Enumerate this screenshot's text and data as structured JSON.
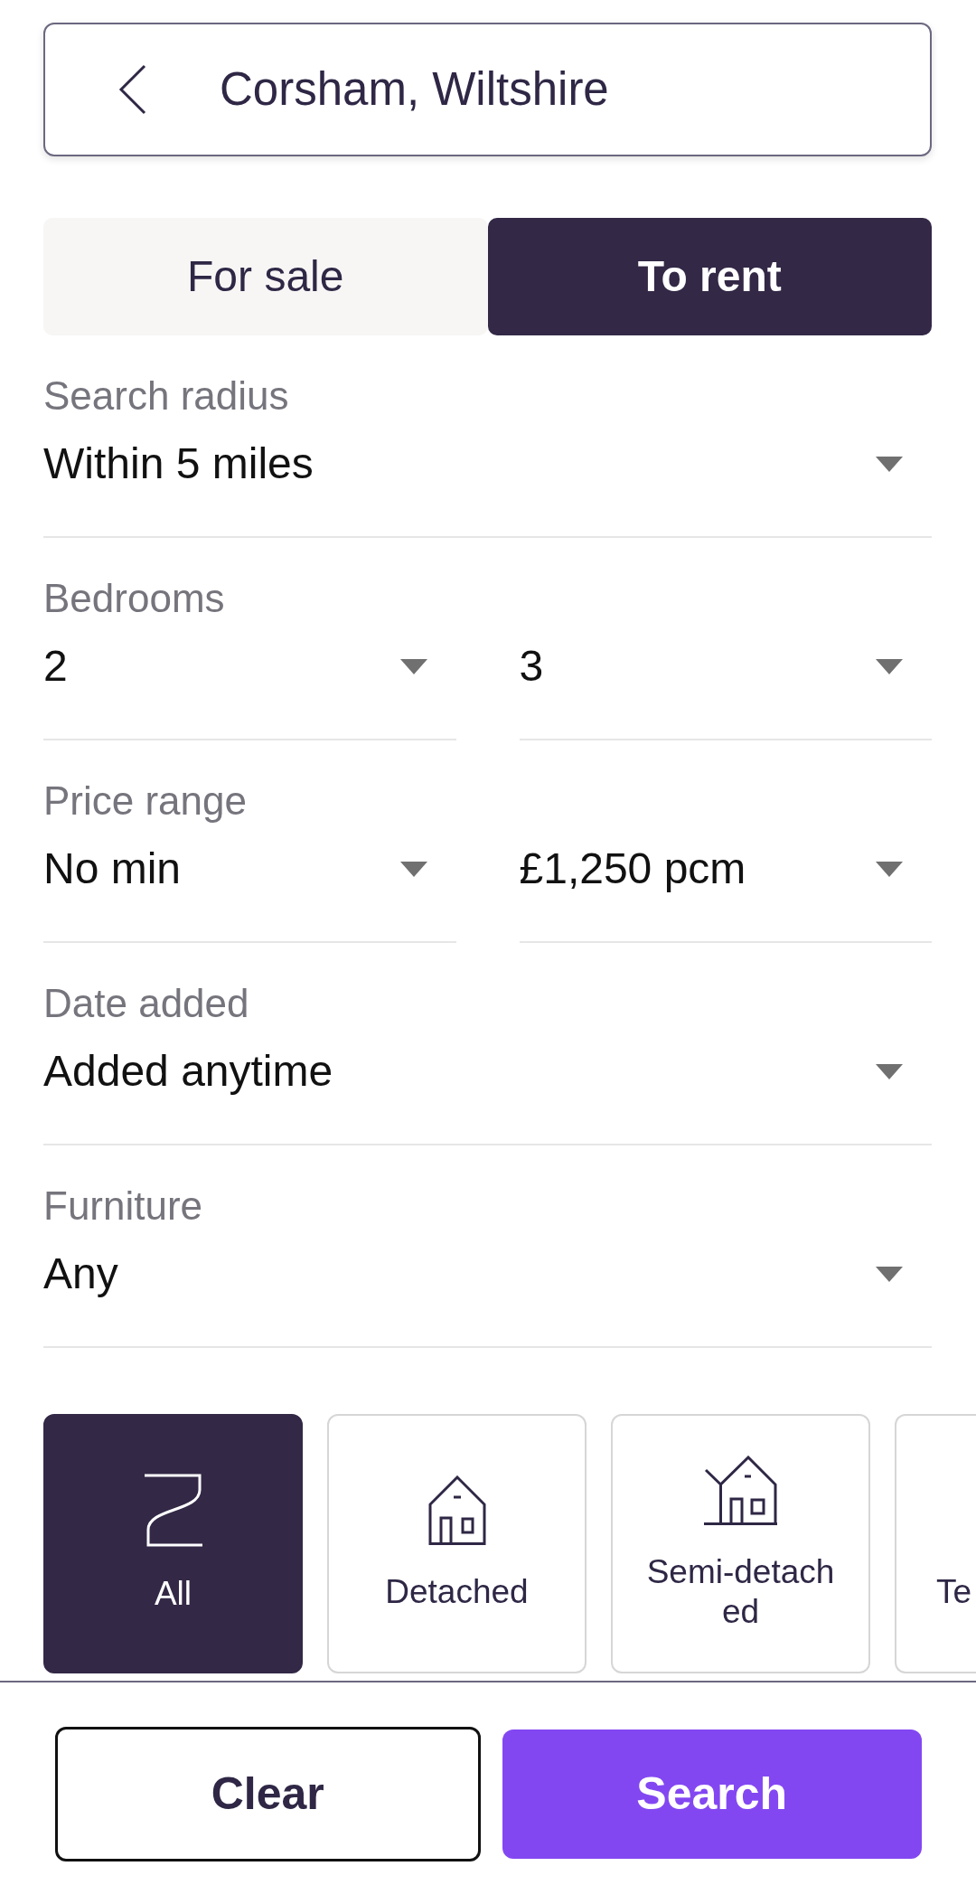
{
  "search_bar": {
    "location": "Corsham, Wiltshire"
  },
  "tabs": [
    {
      "label": "For sale",
      "selected": false
    },
    {
      "label": "To rent",
      "selected": true
    }
  ],
  "filters": [
    {
      "label": "Search radius",
      "dropdowns": [
        {
          "value": "Within 5 miles"
        }
      ]
    },
    {
      "label": "Bedrooms",
      "dropdowns": [
        {
          "value": "2"
        },
        {
          "value": "3"
        }
      ]
    },
    {
      "label": "Price range",
      "dropdowns": [
        {
          "value": "No min"
        },
        {
          "value": "£1,250 pcm"
        }
      ]
    },
    {
      "label": "Date added",
      "dropdowns": [
        {
          "value": "Added anytime"
        }
      ]
    },
    {
      "label": "Furniture",
      "dropdowns": [
        {
          "value": "Any"
        }
      ]
    }
  ],
  "property_types": [
    {
      "label": "All",
      "selected": true,
      "kind": "all"
    },
    {
      "label": "Detached",
      "selected": false,
      "kind": "detached"
    },
    {
      "label": "Semi-detached",
      "selected": false,
      "kind": "semi_detached"
    },
    {
      "label": "Te",
      "selected": false,
      "kind": "cut"
    }
  ],
  "buttons": [
    {
      "label": "Clear",
      "kind": "secondary"
    },
    {
      "label": "Search",
      "kind": "primary"
    }
  ]
}
